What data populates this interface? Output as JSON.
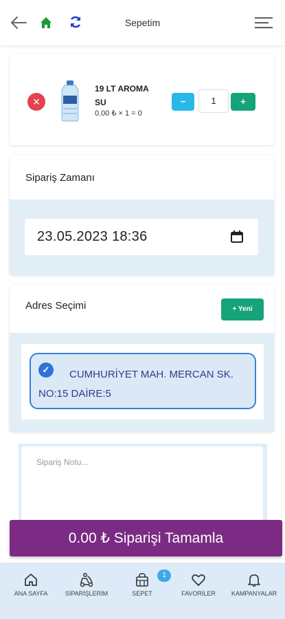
{
  "header": {
    "title": "Sepetim"
  },
  "cart": {
    "item": {
      "name": "19 LT AROMA SU",
      "price_line": "0.00 ₺ × 1 = 0",
      "quantity": "1",
      "remove_symbol": "✕",
      "minus_symbol": "−",
      "plus_symbol": "+"
    }
  },
  "order_time": {
    "title": "Sipariş Zamanı",
    "value": "23.05.2023 18:36"
  },
  "address": {
    "title": "Adres Seçimi",
    "new_button": "+ Yeni",
    "selected": "CUMHURİYET MAH. MERCAN SK. NO:15 DAİRE:5"
  },
  "note": {
    "placeholder": "Sipariş Notu..."
  },
  "complete_button": "0.00 ₺ Siparişi Tamamla",
  "bottom_nav": {
    "items": [
      {
        "label": "ANA SAYFA",
        "icon": "home-icon"
      },
      {
        "label": "SİPARİŞLERİM",
        "icon": "delivery-icon"
      },
      {
        "label": "SEPET",
        "icon": "basket-icon"
      },
      {
        "label": "FAVORİLER",
        "icon": "heart-icon"
      },
      {
        "label": "KAMPANYALAR",
        "icon": "bell-icon"
      }
    ],
    "cart_badge": "1"
  },
  "colors": {
    "accent_purple": "#7b2b83",
    "green": "#17a37a",
    "cyan": "#26b9e8",
    "red": "#e5414e",
    "blue": "#2f73d9"
  }
}
